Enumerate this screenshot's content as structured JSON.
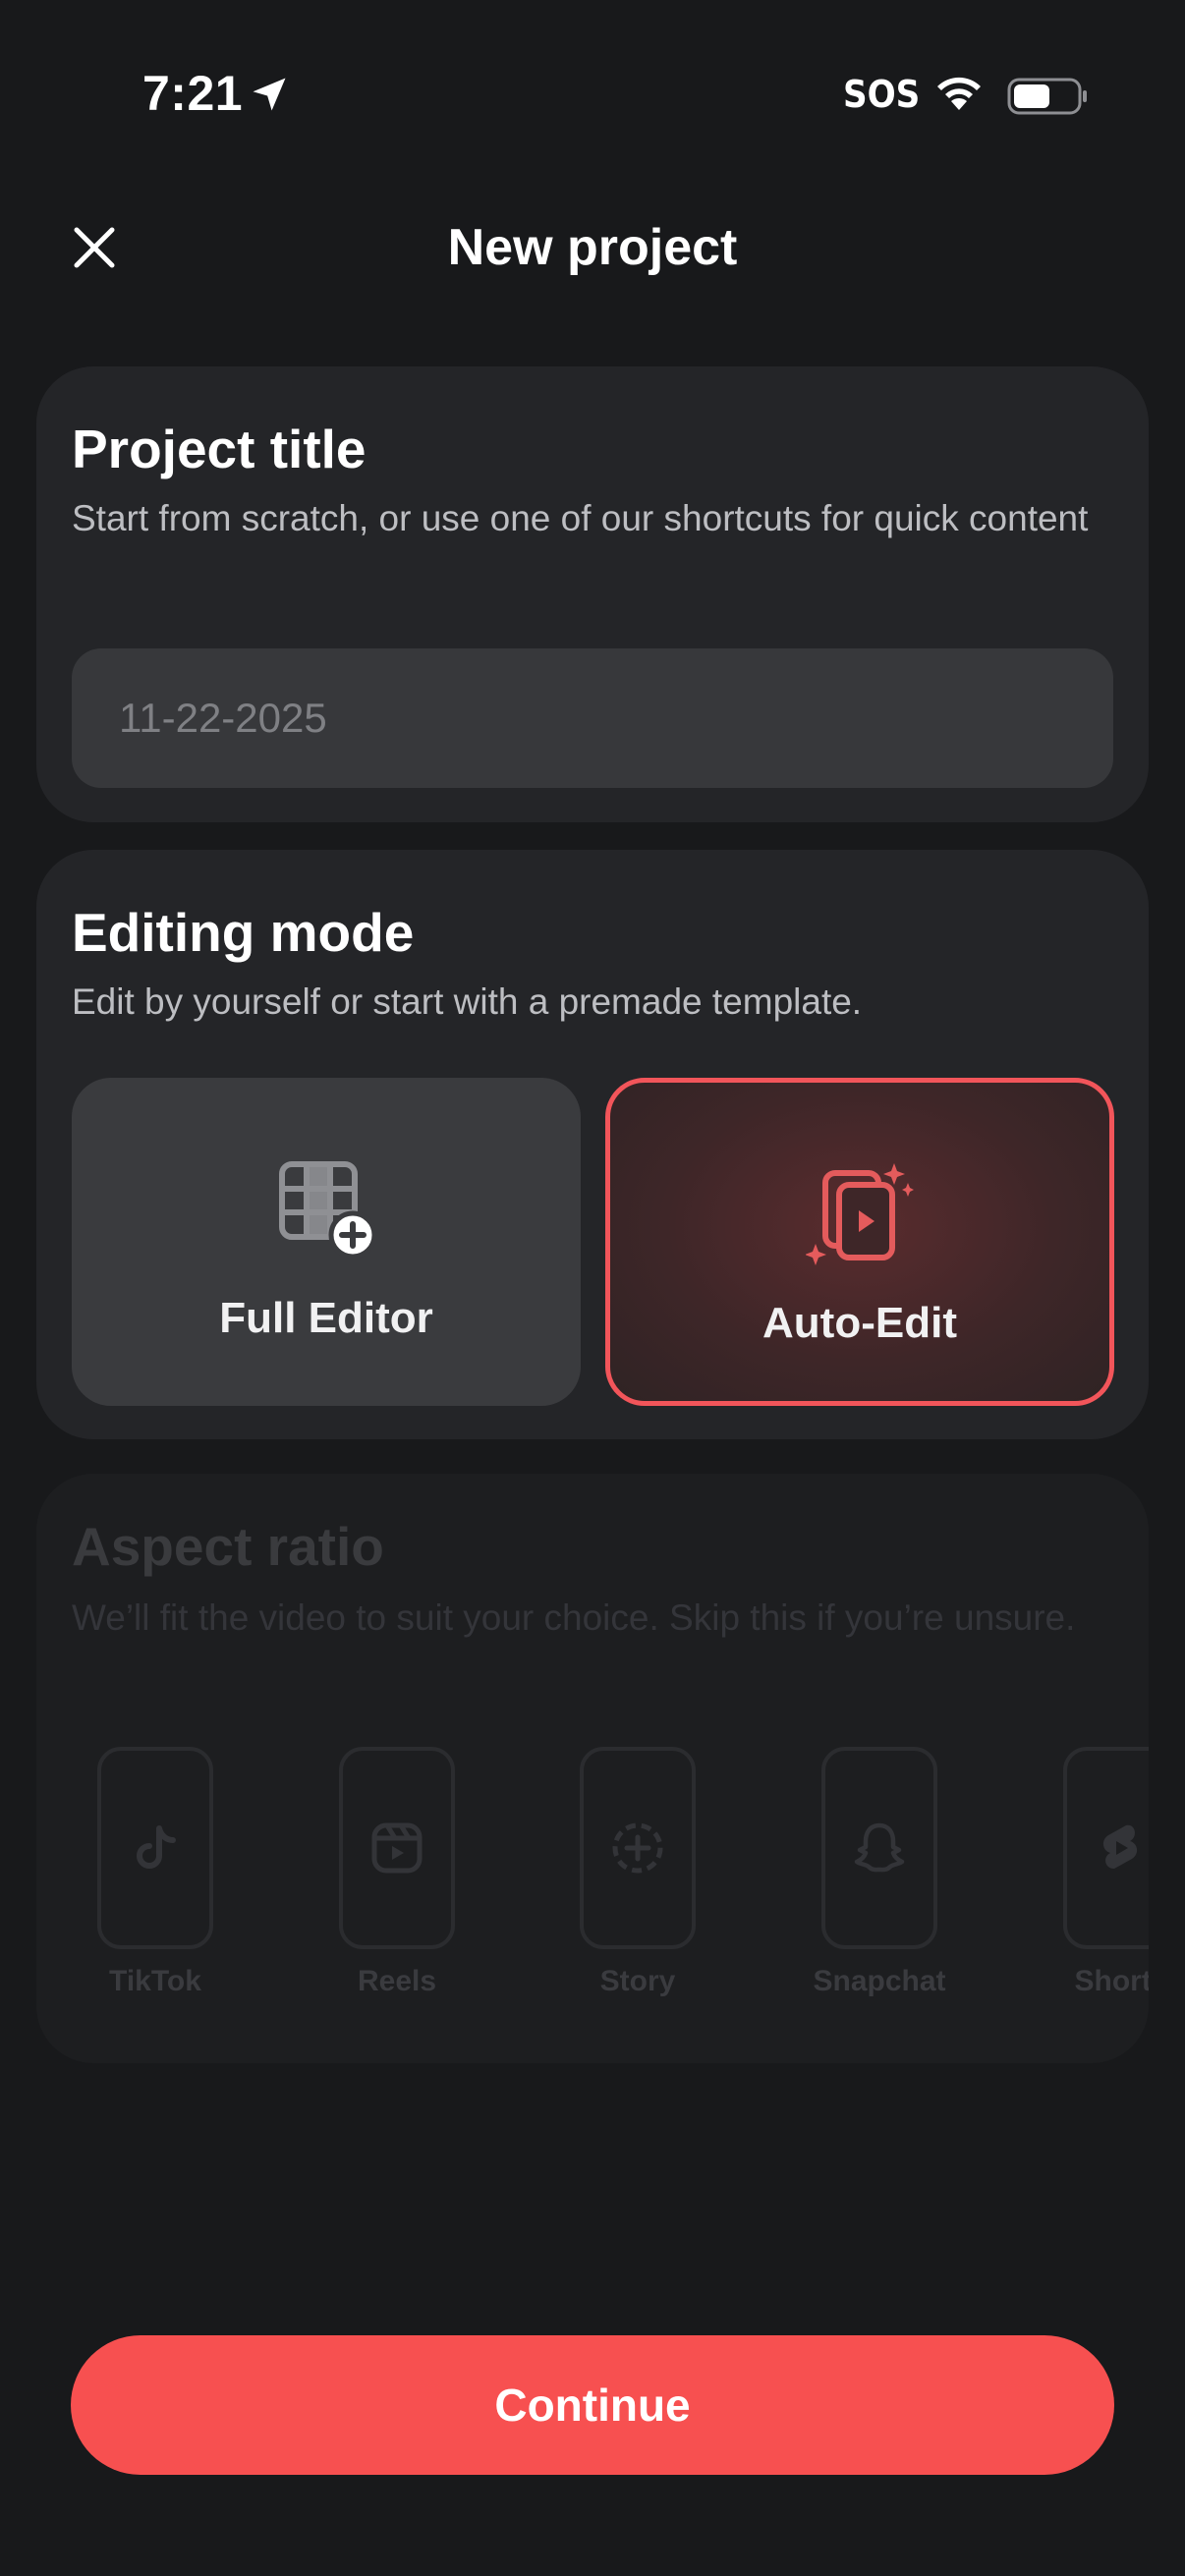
{
  "status_bar": {
    "time": "7:21",
    "sos": "SOS",
    "icons": [
      "location-arrow-icon",
      "wifi-icon",
      "battery-icon"
    ]
  },
  "header": {
    "title": "New project",
    "close_icon": "close-icon"
  },
  "project_title": {
    "heading": "Project title",
    "subtitle": "Start from scratch, or use one of our shortcuts for quick content",
    "input_placeholder": "11-22-2025",
    "input_value": ""
  },
  "editing_mode": {
    "heading": "Editing mode",
    "subtitle": "Edit by yourself or start with a premade template.",
    "options": [
      {
        "label": "Full Editor",
        "icon": "grid-plus-icon",
        "selected": false
      },
      {
        "label": "Auto-Edit",
        "icon": "sparkle-video-icon",
        "selected": true
      }
    ]
  },
  "aspect_ratio": {
    "heading": "Aspect ratio",
    "subtitle": "We’ll fit the video to suit your choice. Skip this if you’re unsure.",
    "options": [
      {
        "label": "TikTok",
        "icon": "tiktok-icon"
      },
      {
        "label": "Reels",
        "icon": "reels-icon"
      },
      {
        "label": "Story",
        "icon": "story-icon"
      },
      {
        "label": "Snapchat",
        "icon": "snapchat-icon"
      },
      {
        "label": "Shorts",
        "icon": "shorts-icon"
      }
    ]
  },
  "footer": {
    "continue_label": "Continue"
  },
  "colors": {
    "background": "#18191b",
    "card": "#242528",
    "accent": "#f75050",
    "selected_border": "#f2555a"
  }
}
